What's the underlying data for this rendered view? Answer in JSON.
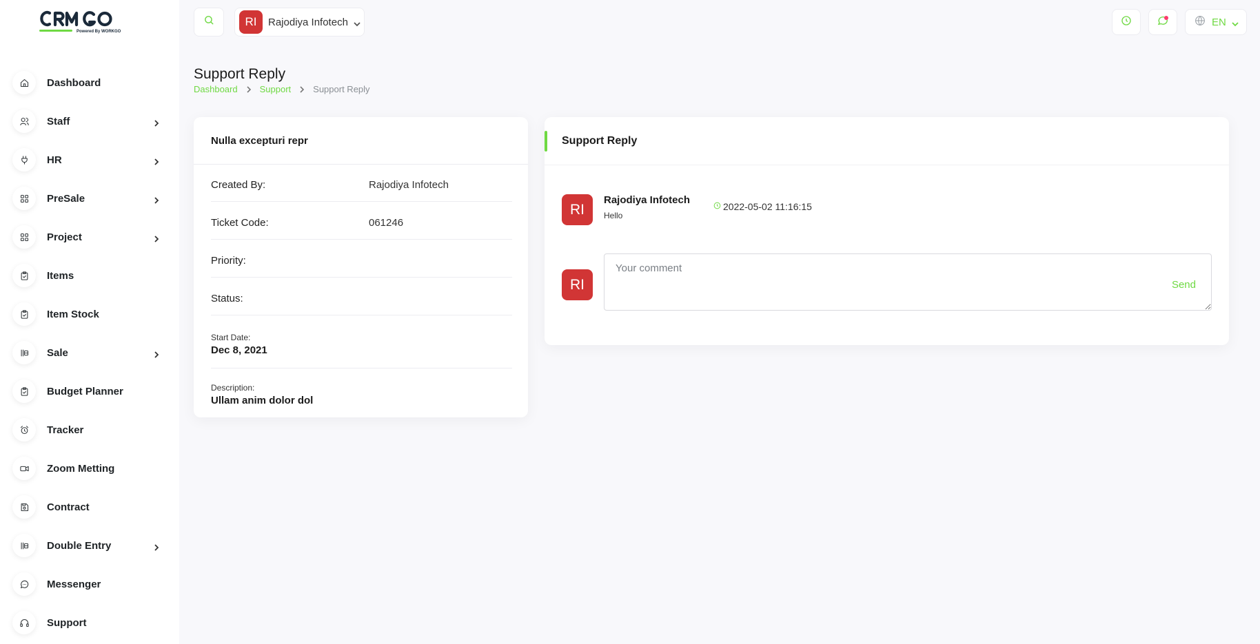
{
  "brand": {
    "logo_text": "CRMGO",
    "tagline": "Powered by WORKGO",
    "accent_color": "#6fd943",
    "avatar_color": "#d13535"
  },
  "sidebar": {
    "items": [
      {
        "label": "Dashboard",
        "icon": "home-icon",
        "has_submenu": false
      },
      {
        "label": "Staff",
        "icon": "users-icon",
        "has_submenu": true
      },
      {
        "label": "HR",
        "icon": "plug-icon",
        "has_submenu": true
      },
      {
        "label": "PreSale",
        "icon": "grid-icon",
        "has_submenu": true
      },
      {
        "label": "Project",
        "icon": "grid-icon",
        "has_submenu": true
      },
      {
        "label": "Items",
        "icon": "clipboard-check-icon",
        "has_submenu": false
      },
      {
        "label": "Item Stock",
        "icon": "clipboard-check-icon",
        "has_submenu": false
      },
      {
        "label": "Sale",
        "icon": "columns-icon",
        "has_submenu": true
      },
      {
        "label": "Budget Planner",
        "icon": "clipboard-check-icon",
        "has_submenu": false
      },
      {
        "label": "Tracker",
        "icon": "alarm-clock-icon",
        "has_submenu": false
      },
      {
        "label": "Zoom Metting",
        "icon": "video-icon",
        "has_submenu": false
      },
      {
        "label": "Contract",
        "icon": "device-floppy-icon",
        "has_submenu": false
      },
      {
        "label": "Double Entry",
        "icon": "columns-icon",
        "has_submenu": true
      },
      {
        "label": "Messenger",
        "icon": "message-circle-icon",
        "has_submenu": false
      },
      {
        "label": "Support",
        "icon": "headphones-icon",
        "has_submenu": false
      }
    ]
  },
  "header": {
    "company": {
      "initials": "RI",
      "name": "Rajodiya Infotech"
    },
    "language": "EN"
  },
  "page": {
    "title": "Support Reply",
    "breadcrumb": [
      "Dashboard",
      "Support",
      "Support Reply"
    ]
  },
  "ticket": {
    "title": "Nulla excepturi repr",
    "fields": [
      {
        "label": "Created By:",
        "value": "Rajodiya Infotech"
      },
      {
        "label": "Ticket Code:",
        "value": "061246"
      },
      {
        "label": "Priority:",
        "value": ""
      },
      {
        "label": "Status:",
        "value": ""
      }
    ],
    "start_date": {
      "label": "Start Date:",
      "value": "Dec 8, 2021"
    },
    "description": {
      "label": "Description:",
      "value": "Ullam anim dolor dol"
    }
  },
  "reply": {
    "title": "Support Reply",
    "messages": [
      {
        "initials": "RI",
        "author": "Rajodiya Infotech",
        "text": "Hello",
        "timestamp": "2022-05-02 11:16:15"
      }
    ],
    "comment": {
      "initials": "RI",
      "placeholder": "Your comment",
      "send_label": "Send"
    }
  }
}
